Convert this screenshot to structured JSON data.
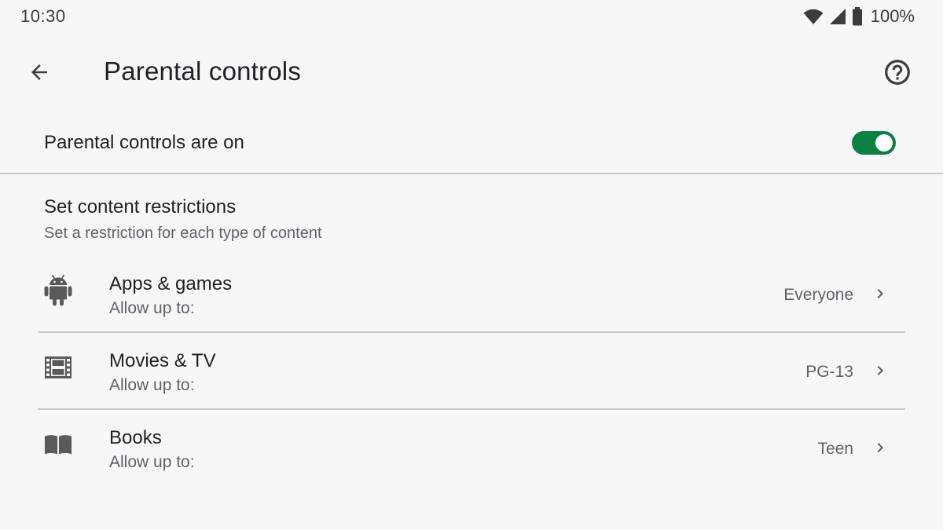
{
  "status_bar": {
    "time": "10:30",
    "battery_percent": "100%",
    "icons": [
      "wifi-icon",
      "signal-icon",
      "battery-icon"
    ]
  },
  "header": {
    "title": "Parental controls",
    "back_icon": "arrow-back-icon",
    "help_icon": "help-circle-icon"
  },
  "master_toggle": {
    "label": "Parental controls are on",
    "enabled": true,
    "accent_color": "#0b8043"
  },
  "restrictions": {
    "title": "Set content restrictions",
    "subtitle": "Set a restriction for each type of content",
    "items": [
      {
        "icon": "android-icon",
        "title": "Apps & games",
        "subtitle": "Allow up to:",
        "value": "Everyone"
      },
      {
        "icon": "film-icon",
        "title": "Movies & TV",
        "subtitle": "Allow up to:",
        "value": "PG-13"
      },
      {
        "icon": "book-icon",
        "title": "Books",
        "subtitle": "Allow up to:",
        "value": "Teen"
      }
    ]
  }
}
